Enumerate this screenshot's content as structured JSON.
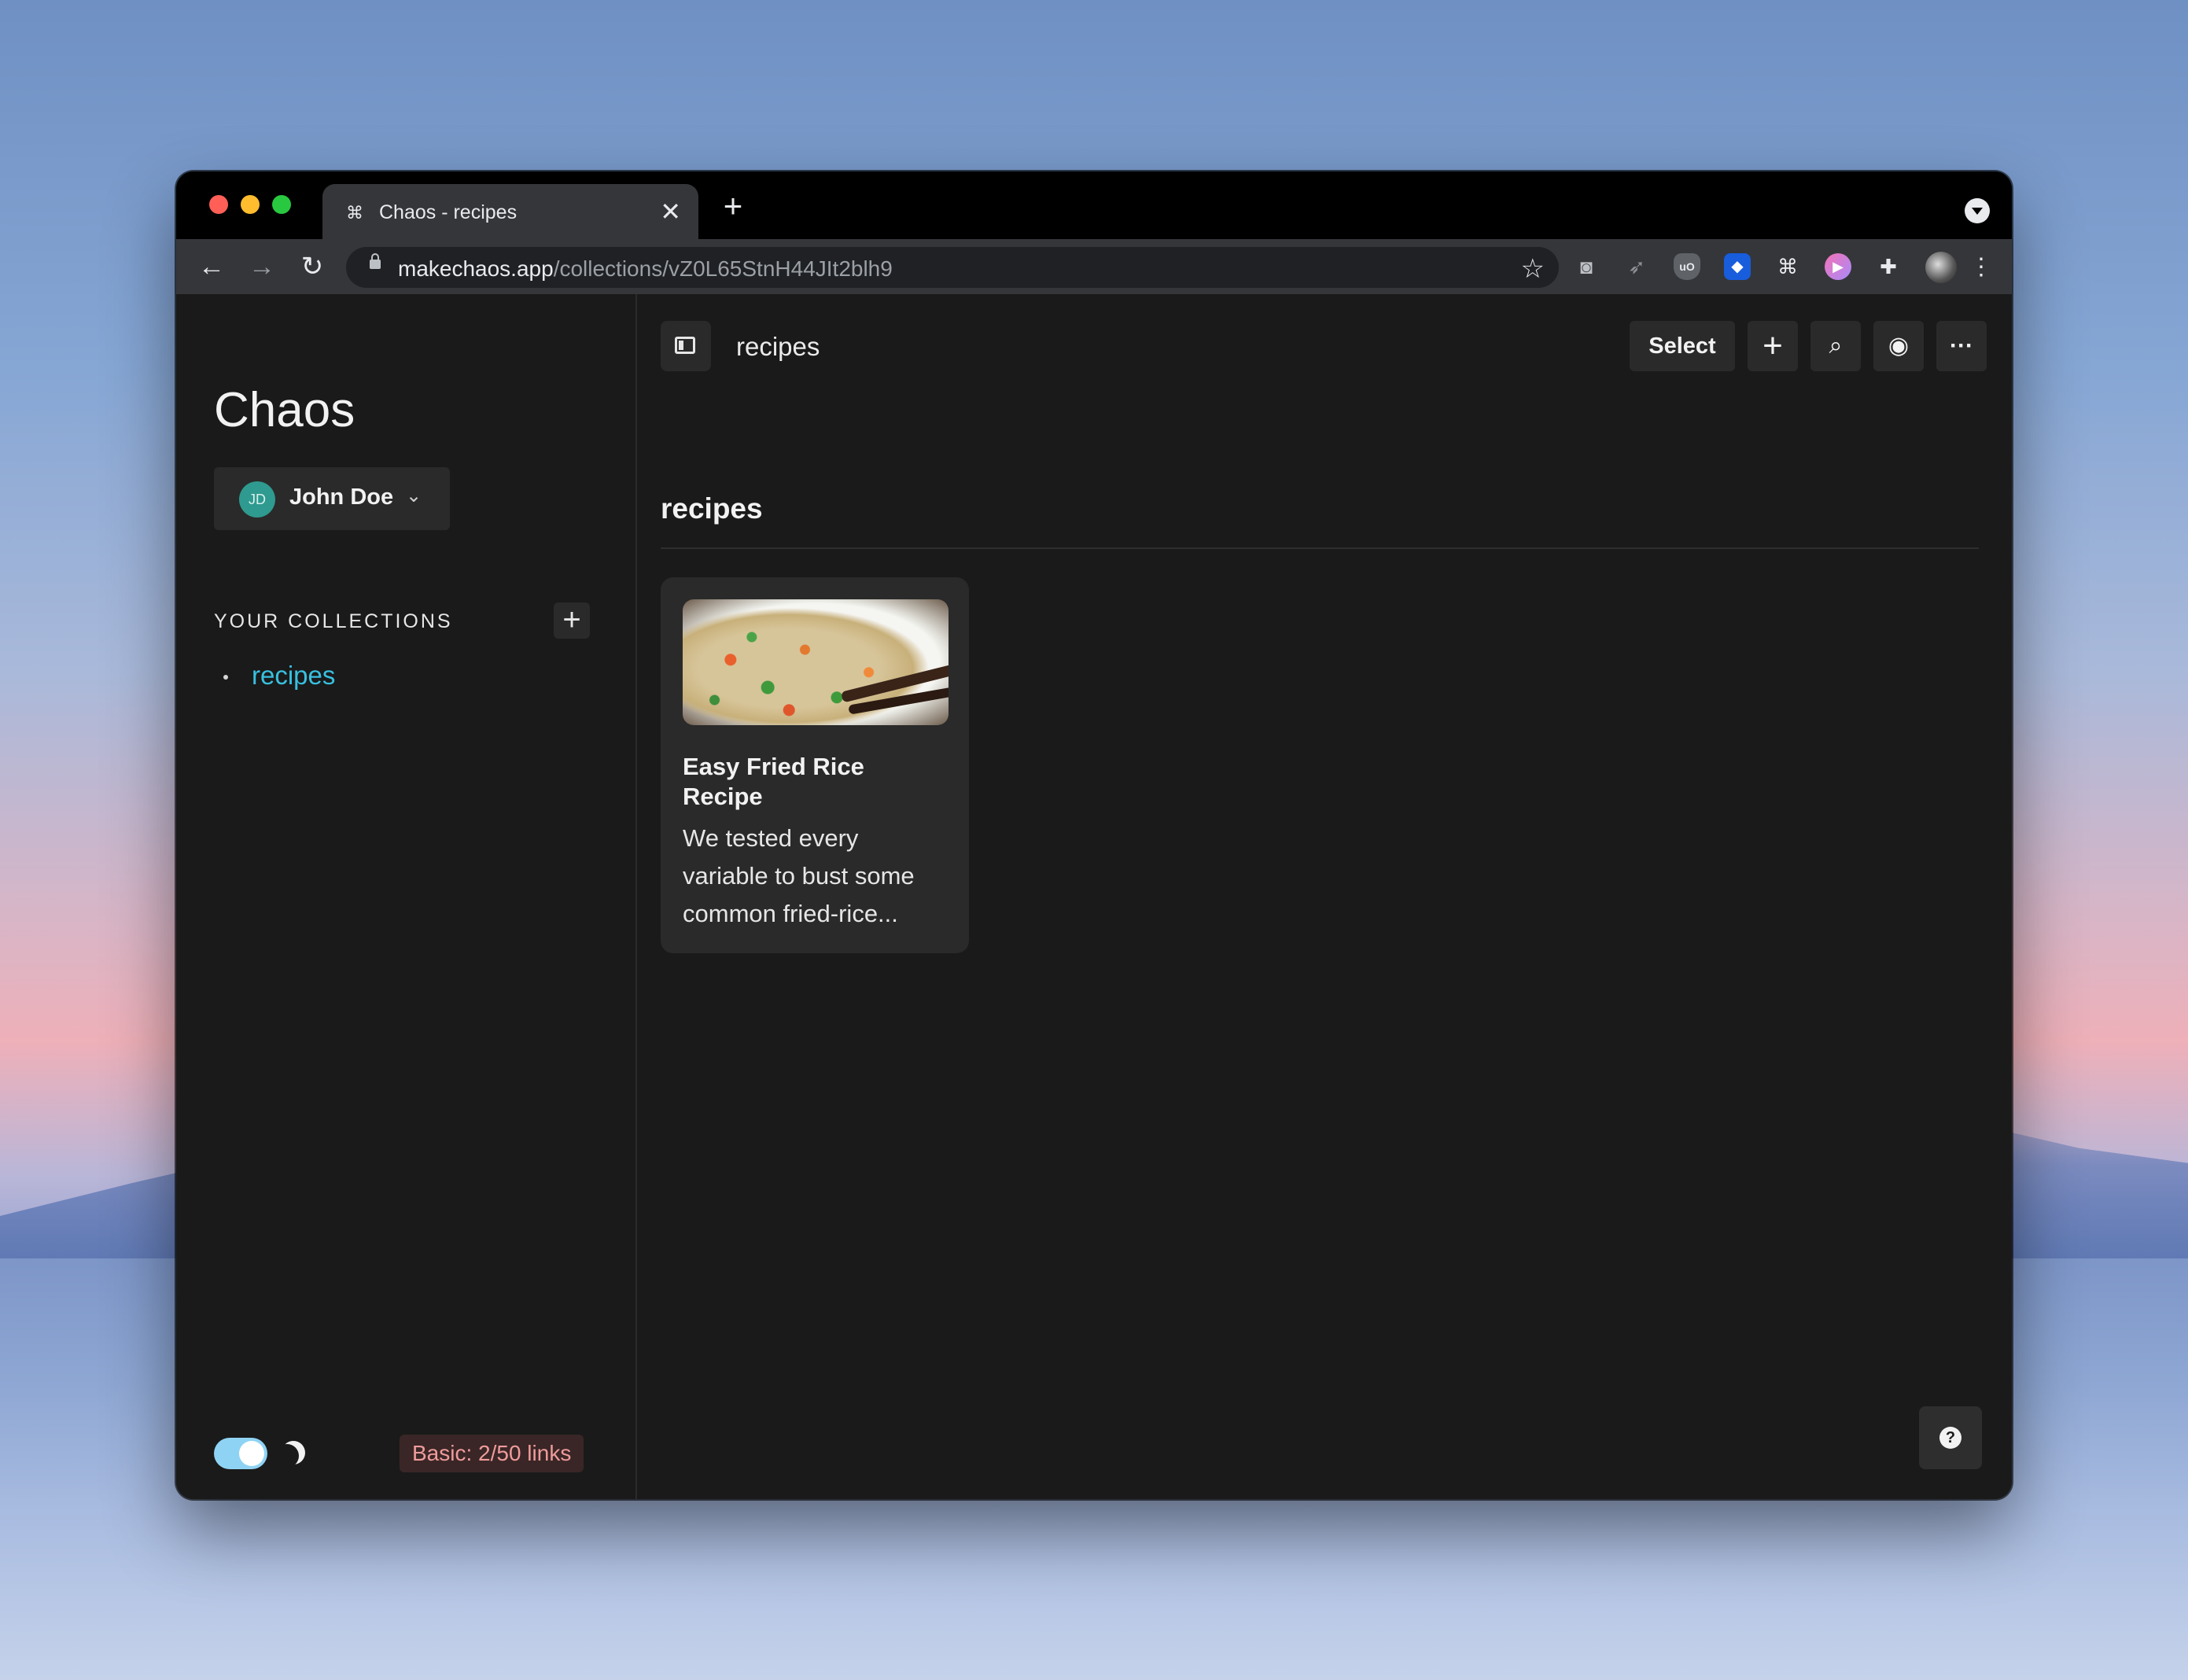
{
  "browser": {
    "tab_title": "Chaos - recipes",
    "tab_close": "✕",
    "new_tab": "+",
    "url_host": "makechaos.app",
    "url_path": "/collections/vZ0L65StnH44JIt2blh9"
  },
  "sidebar": {
    "brand": "Chaos",
    "user": {
      "initials": "JD",
      "name": "John Doe"
    },
    "collections_heading": "YOUR COLLECTIONS",
    "collections": [
      {
        "label": "recipes"
      }
    ],
    "plan_badge": "Basic: 2/50 links"
  },
  "header": {
    "breadcrumb": "recipes",
    "select_label": "Select"
  },
  "section": {
    "title": "recipes",
    "cards": [
      {
        "title": "Easy Fried Rice Recipe",
        "description": "We tested every variable to bust some common fried-rice..."
      }
    ]
  },
  "help_label": "?",
  "colors": {
    "accent": "#38c0e0",
    "avatar": "#2f9a8f",
    "badge_text": "#ef9b9b",
    "toggle": "#8fd3f4"
  }
}
